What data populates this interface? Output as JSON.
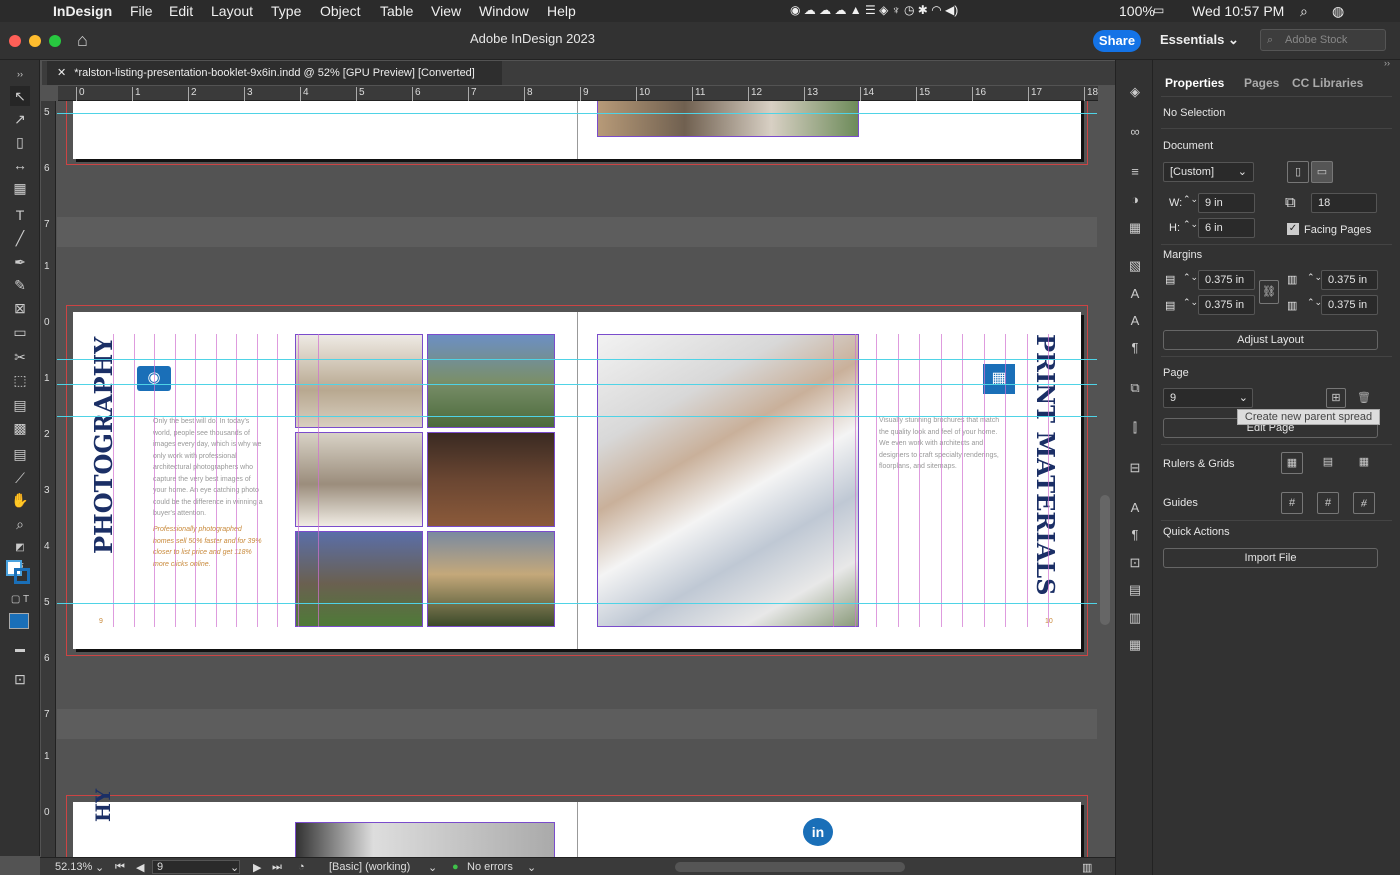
{
  "menubar": {
    "app": "InDesign",
    "items": [
      "File",
      "Edit",
      "Layout",
      "Type",
      "Object",
      "Table",
      "View",
      "Window",
      "Help"
    ],
    "battery": "100%",
    "datetime": "Wed 10:57 PM"
  },
  "titlebar": {
    "title": "Adobe InDesign 2023",
    "share": "Share",
    "workspace": "Essentials",
    "stock_placeholder": "Adobe Stock"
  },
  "doc_tab": {
    "label": "*ralston-listing-presentation-booklet-9x6in.indd @ 52% [GPU Preview] [Converted]"
  },
  "ruler": {
    "h_ticks": [
      "0",
      "1",
      "2",
      "3",
      "4",
      "5",
      "6",
      "7",
      "8",
      "9",
      "10",
      "11",
      "12",
      "13",
      "14",
      "15",
      "16",
      "17",
      "18"
    ],
    "v_ticks": [
      "5",
      "6",
      "7",
      "1",
      "0",
      "1",
      "2",
      "3",
      "4",
      "5",
      "6",
      "7",
      "1",
      "0"
    ]
  },
  "spread": {
    "left_title": "PHOTOGRAPHY",
    "left_body": "Only the best will do. In today's world, people see thousands of images every day, which is why we only work with professional architectural photographers who capture the very best images of your home. An eye catching photo could be the difference in winning a buyer's attention.",
    "left_highlight": "Professionally photographed homes sell 50% faster and for 39% closer to list price and get 118% more clicks online.",
    "left_page_num": "9",
    "right_title": "PRINT MATERIALS",
    "right_body": "Visually stunning brochures that match the quality look and feel of your home. We even work with architects and designers to craft specialty renderings, floorplans, and sitemaps.",
    "right_page_num": "10"
  },
  "status": {
    "zoom": "52.13%",
    "page": "9",
    "style": "[Basic] (working)",
    "errors": "No errors"
  },
  "panel": {
    "tabs": [
      "Properties",
      "Pages",
      "CC Libraries"
    ],
    "selection": "No Selection",
    "document_label": "Document",
    "preset": "[Custom]",
    "w_label": "W:",
    "w": "9 in",
    "h_label": "H:",
    "h": "6 in",
    "pages": "18",
    "facing": "Facing Pages",
    "margins_label": "Margins",
    "m_top": "0.375 in",
    "m_bottom": "0.375 in",
    "m_left": "0.375 in",
    "m_right": "0.375 in",
    "adjust": "Adjust Layout",
    "page_label": "Page",
    "page_value": "9",
    "edit_page": "Edit Page",
    "tooltip": "Create new parent spread",
    "rulers": "Rulers & Grids",
    "guides": "Guides",
    "quick": "Quick Actions",
    "import": "Import File"
  },
  "colors": {
    "accent": "#1473e6",
    "navy": "#1b2f66",
    "orange": "#c8893a"
  }
}
